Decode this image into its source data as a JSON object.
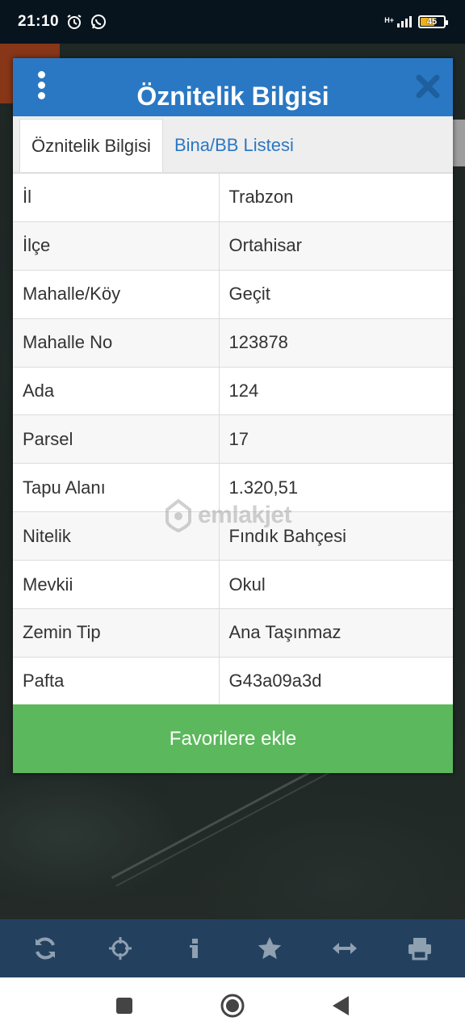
{
  "status_bar": {
    "time": "21:10",
    "network": "H+",
    "battery": "45",
    "icons": [
      "alarm-icon",
      "whatsapp-icon",
      "signal-icon",
      "battery-icon"
    ]
  },
  "dialog": {
    "title": "Öznitelik Bilgisi",
    "tabs": [
      {
        "label": "Öznitelik Bilgisi",
        "active": true
      },
      {
        "label": "Bina/BB Listesi",
        "active": false
      }
    ],
    "rows": [
      {
        "key": "İl",
        "value": "Trabzon"
      },
      {
        "key": "İlçe",
        "value": "Ortahisar"
      },
      {
        "key": "Mahalle/Köy",
        "value": "Geçit"
      },
      {
        "key": "Mahalle No",
        "value": "123878"
      },
      {
        "key": "Ada",
        "value": "124"
      },
      {
        "key": "Parsel",
        "value": "17"
      },
      {
        "key": "Tapu Alanı",
        "value": "1.320,51"
      },
      {
        "key": "Nitelik",
        "value": "Fındık Bahçesi"
      },
      {
        "key": "Mevkii",
        "value": "Okul"
      },
      {
        "key": "Zemin Tip",
        "value": "Ana Taşınmaz"
      },
      {
        "key": "Pafta",
        "value": "G43a09a3d"
      }
    ],
    "favorite_button": "Favorilere ekle"
  },
  "watermark": "emlakjet",
  "toolbar": {
    "icons": [
      "refresh-icon",
      "locate-icon",
      "info-icon",
      "star-icon",
      "measure-icon",
      "print-icon"
    ]
  },
  "colors": {
    "header_blue": "#2a78c3",
    "favorite_green": "#5cb85c",
    "toolbar_bg": "#23415f",
    "toolbar_icon": "#8fa0b0"
  }
}
